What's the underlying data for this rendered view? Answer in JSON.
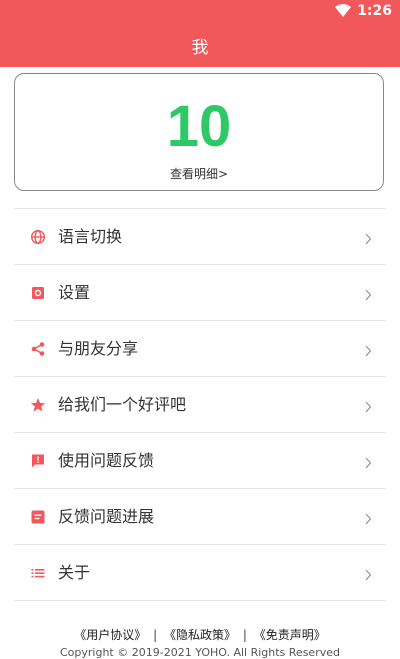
{
  "status": {
    "time": "1:26",
    "wifi_icon": "wifi-icon"
  },
  "header": {
    "title": "我",
    "background": "#f2575b"
  },
  "summary_card": {
    "value": "10",
    "value_color": "#2ec866",
    "link_label": "查看明细>"
  },
  "menu": {
    "icon_color": "#f2575b",
    "items": [
      {
        "label": "语言切换",
        "icon": "globe-icon"
      },
      {
        "label": "设置",
        "icon": "settings-icon"
      },
      {
        "label": "与朋友分享",
        "icon": "share-icon"
      },
      {
        "label": "给我们一个好评吧",
        "icon": "star-icon"
      },
      {
        "label": "使用问题反馈",
        "icon": "feedback-icon"
      },
      {
        "label": "反馈问题进展",
        "icon": "document-icon"
      },
      {
        "label": "关于",
        "icon": "list-icon"
      }
    ]
  },
  "footer": {
    "user_agreement": "《用户协议》",
    "separator": "|",
    "privacy_policy": "《隐私政策》",
    "disclaimer": "《免责声明》",
    "copyright": "Copyright © 2019-2021 YOHO. All Rights Reserved"
  }
}
